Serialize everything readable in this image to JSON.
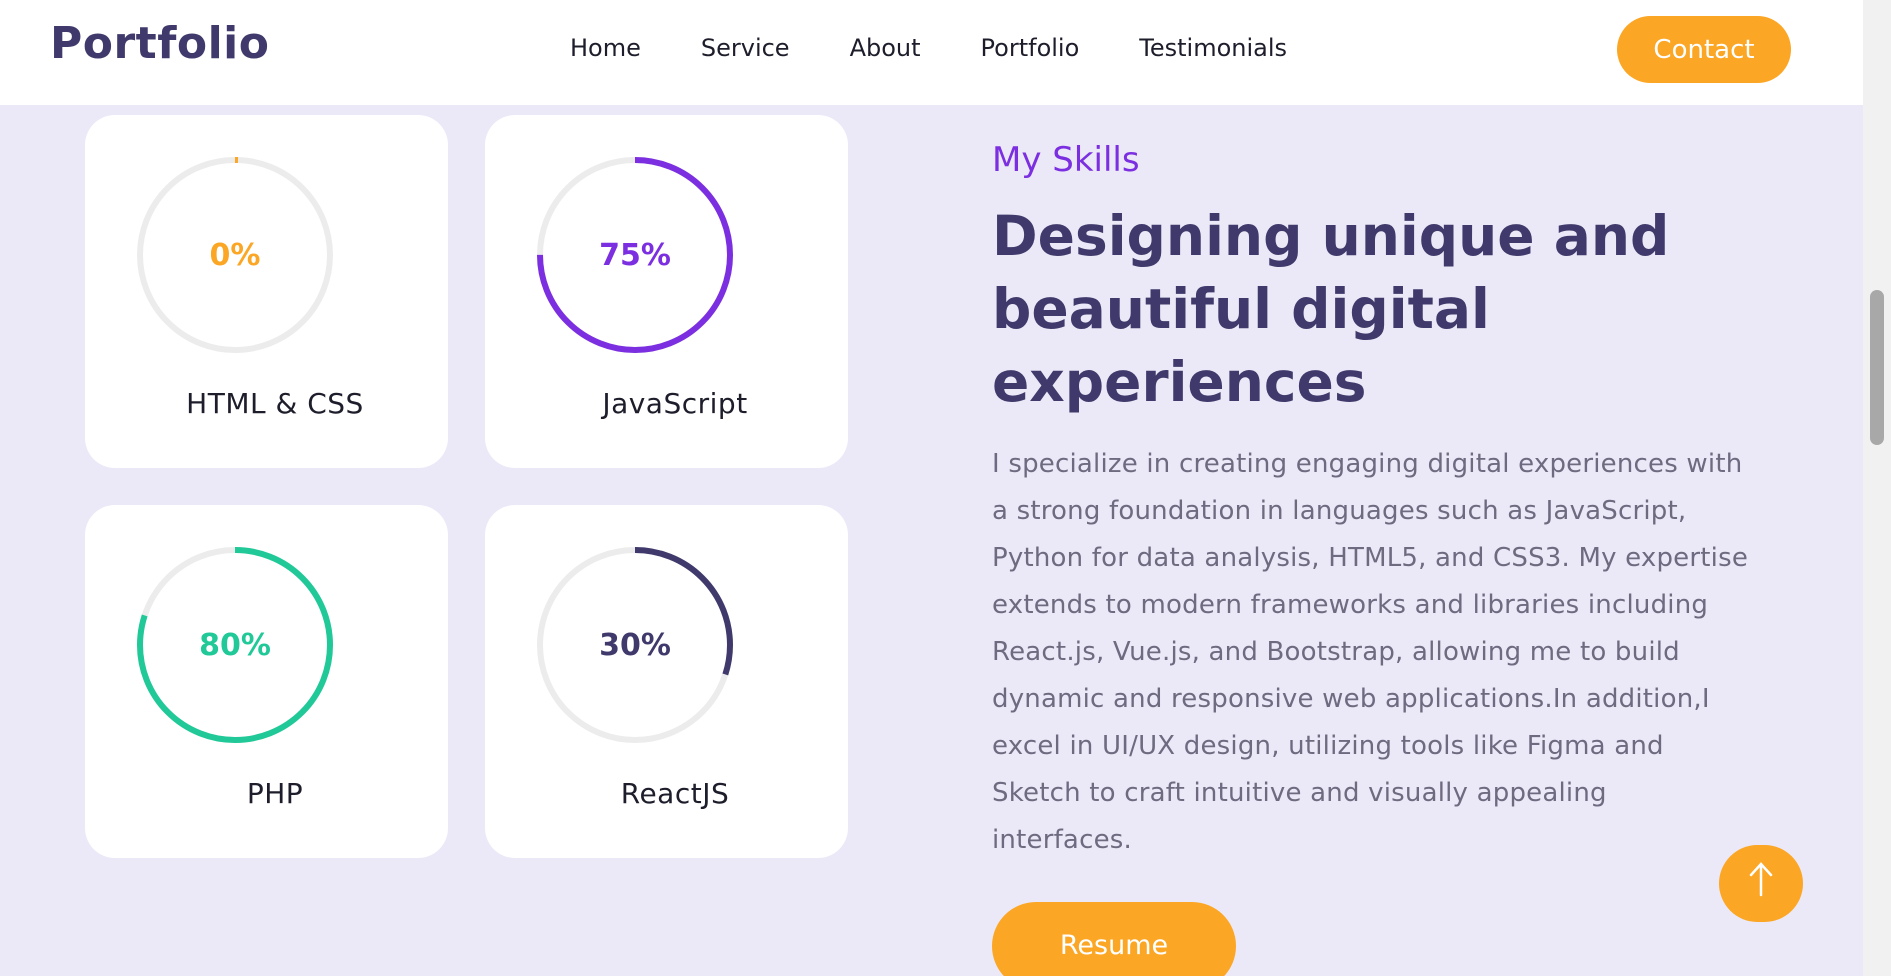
{
  "header": {
    "logo": "Portfolio",
    "nav": [
      "Home",
      "Service",
      "About",
      "Portfolio",
      "Testimonials"
    ],
    "contact_label": "Contact"
  },
  "skills": [
    {
      "label": "HTML & CSS",
      "percent_text": "0%",
      "percent": 0,
      "color": "#fba624"
    },
    {
      "label": "JavaScript",
      "percent_text": "75%",
      "percent": 75,
      "color": "#7b2fe0"
    },
    {
      "label": "PHP",
      "percent_text": "80%",
      "percent": 80,
      "color": "#20c997"
    },
    {
      "label": "ReactJS",
      "percent_text": "30%",
      "percent": 30,
      "color": "#3f3a6b"
    }
  ],
  "about": {
    "kicker": "My Skills",
    "headline": "Designing unique and beautiful digital experiences",
    "description": "I specialize in creating engaging digital experiences with a strong foundation in languages such as JavaScript, Python for data analysis, HTML5, and CSS3. My expertise extends to modern frameworks and libraries including React.js, Vue.js, and Bootstrap, allowing me to build dynamic and responsive web applications.In addition,I excel in UI/UX design, utilizing tools like Figma and Sketch to craft intuitive and visually appealing interfaces.",
    "resume_label": "Resume"
  },
  "icons": {
    "scroll_top": "arrow-up-icon"
  },
  "colors": {
    "accent": "#fba624",
    "brand": "#3f3a6b",
    "background": "#ebe9f7"
  }
}
